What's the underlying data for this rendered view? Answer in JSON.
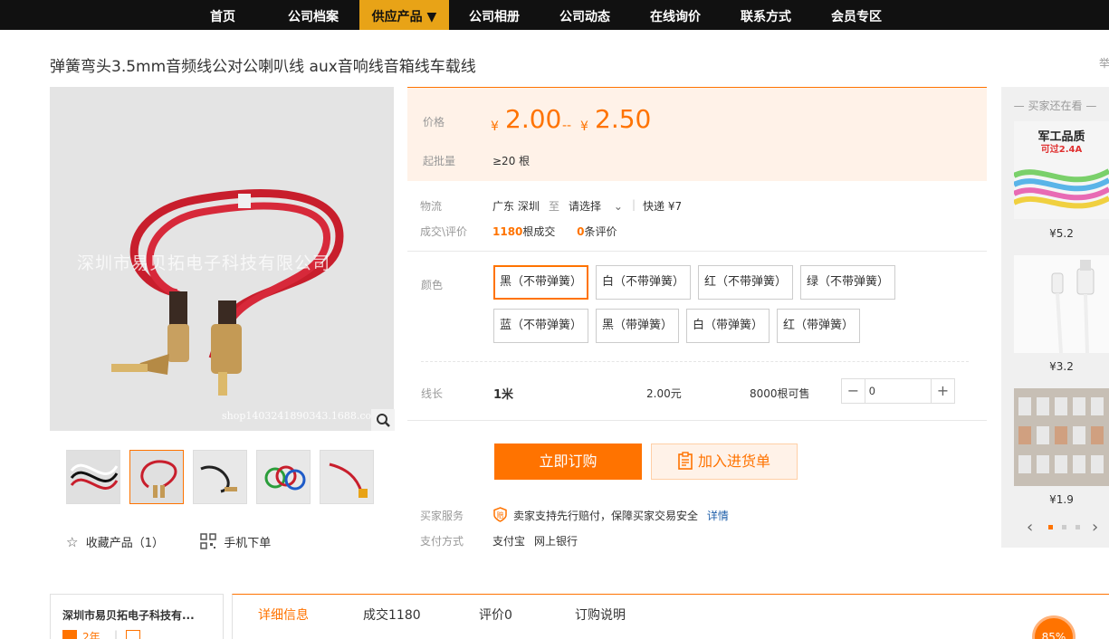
{
  "nav": {
    "items": [
      "首页",
      "公司档案",
      "供应产品 ▼",
      "公司相册",
      "公司动态",
      "在线询价",
      "联系方式",
      "会员专区"
    ]
  },
  "product": {
    "title": "弹簧弯头3.5mm音频线公对公喇叭线 aux音响线音箱线车载线",
    "report": "举",
    "watermark": "深圳市易贝拓电子科技有限公司",
    "shop_code": "shop1403241890343.1688.com"
  },
  "price": {
    "label": "价格",
    "currency": "¥",
    "low": "2.00",
    "dash": "--",
    "high": "2.50",
    "moq_label": "起批量",
    "moq_value": "≥20 根"
  },
  "logistics": {
    "label": "物流",
    "origin": "广东 深圳",
    "to": "至",
    "select": "请选择",
    "express": "快递 ¥7"
  },
  "deals": {
    "label": "成交\\评价",
    "count": "1180",
    "count_unit": "根成交",
    "reviews": "0",
    "reviews_unit": "条评价"
  },
  "color": {
    "label": "颜色",
    "options": [
      "黑（不带弹簧）",
      "白（不带弹簧）",
      "红（不带弹簧）",
      "绿（不带弹簧）",
      "蓝（不带弹簧）",
      "黑（带弹簧）",
      "白（带弹簧）",
      "红（带弹簧）"
    ],
    "selected_index": 0
  },
  "length": {
    "label": "线长",
    "value": "1米",
    "price": "2.00元",
    "stock": "8000根可售",
    "minus": "−",
    "quantity": "0",
    "plus": "+"
  },
  "actions": {
    "order": "立即订购",
    "cart": "加入进货单"
  },
  "service": {
    "label": "买家服务",
    "text": "卖家支持先行赔付，保障买家交易安全",
    "detail": "详情",
    "pay_label": "支付方式",
    "pay_methods": [
      "支付宝",
      "网上银行"
    ]
  },
  "gallery": {
    "favorite": "收藏产品（1）",
    "mobile_order": "手机下单"
  },
  "side": {
    "title": "买家还在看",
    "banner_text": "军工品质",
    "banner_sub": "可过2.4A",
    "prices": [
      "¥5.2",
      "¥3.2",
      "¥1.9"
    ]
  },
  "company": {
    "name": "深圳市易贝拓电子科技有...",
    "years": "2年"
  },
  "tabs": [
    "详细信息",
    "成交1180",
    "评价0",
    "订购说明"
  ],
  "badge": "85%",
  "colors": {
    "accent": "#ff7300",
    "nav_active": "#e8a317",
    "price_bg": "#fff2e8"
  }
}
